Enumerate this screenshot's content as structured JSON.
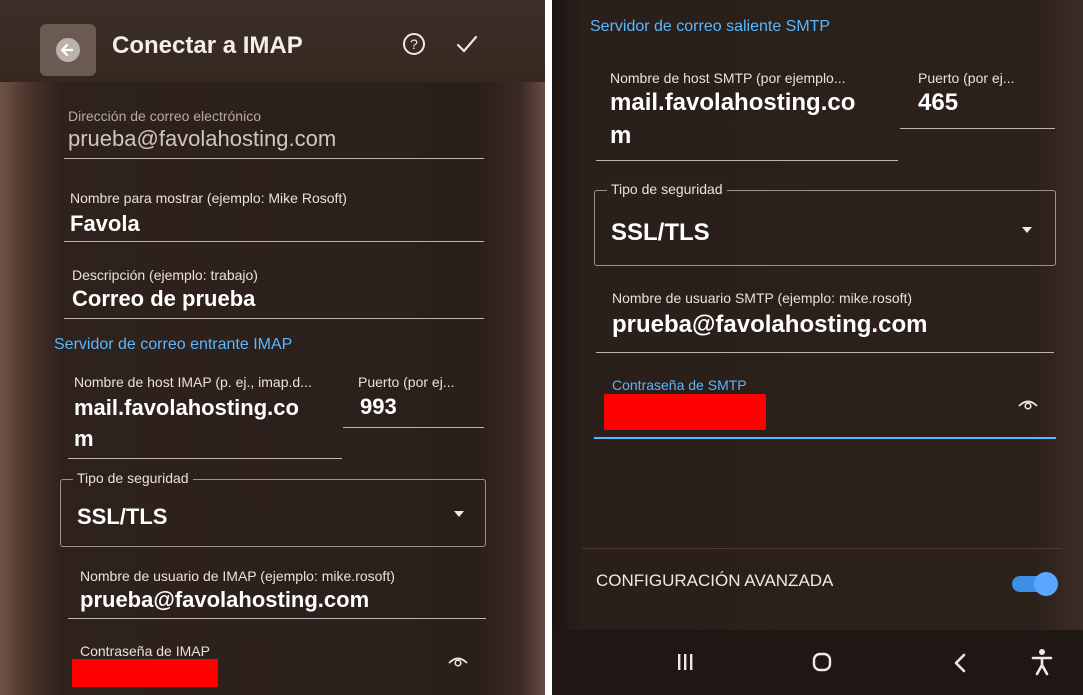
{
  "left": {
    "toolbar": {
      "title": "Conectar a IMAP",
      "back_icon": "arrow-back-icon",
      "help_icon": "help-circle-icon",
      "confirm_icon": "check-icon"
    },
    "email": {
      "label": "Dirección de correo electrónico",
      "value": "prueba@favolahosting.com"
    },
    "display_name": {
      "label": "Nombre para mostrar (ejemplo: Mike Rosoft)",
      "value": "Favola"
    },
    "description": {
      "label": "Descripción (ejemplo: trabajo)",
      "value": "Correo de prueba"
    },
    "incoming_section": "Servidor de correo entrante IMAP",
    "imap_host": {
      "label": "Nombre de host IMAP (p. ej., imap.d...",
      "value_line1": "mail.favolahosting.co",
      "value_line2": "m"
    },
    "imap_port": {
      "label": "Puerto (por ej...",
      "value": "993"
    },
    "security": {
      "legend": "Tipo de seguridad",
      "value": "SSL/TLS"
    },
    "imap_user": {
      "label": "Nombre de usuario de IMAP (ejemplo: mike.rosoft)",
      "value": "prueba@favolahosting.com"
    },
    "imap_password": {
      "label": "Contraseña de IMAP",
      "eye_icon": "eye-icon"
    }
  },
  "right": {
    "outgoing_section": "Servidor de correo saliente SMTP",
    "smtp_host": {
      "label": "Nombre de host SMTP (por ejemplo...",
      "value_line1": "mail.favolahosting.co",
      "value_line2": "m"
    },
    "smtp_port": {
      "label": "Puerto (por ej...",
      "value": "465"
    },
    "security": {
      "legend": "Tipo de seguridad",
      "value": "SSL/TLS"
    },
    "smtp_user": {
      "label": "Nombre de usuario SMTP (ejemplo: mike.rosoft)",
      "value": "prueba@favolahosting.com"
    },
    "smtp_password": {
      "label": "Contraseña de SMTP",
      "eye_icon": "eye-icon"
    },
    "advanced": {
      "label": "CONFIGURACIÓN AVANZADA",
      "enabled": true
    },
    "navbar": {
      "recents_icon": "recents-icon",
      "home_icon": "home-icon",
      "back_icon": "nav-back-icon",
      "accessibility_icon": "accessibility-icon"
    }
  },
  "colors": {
    "accent": "#58b7ff",
    "redaction": "#ff0000",
    "toggle": "#3d8fe6"
  }
}
